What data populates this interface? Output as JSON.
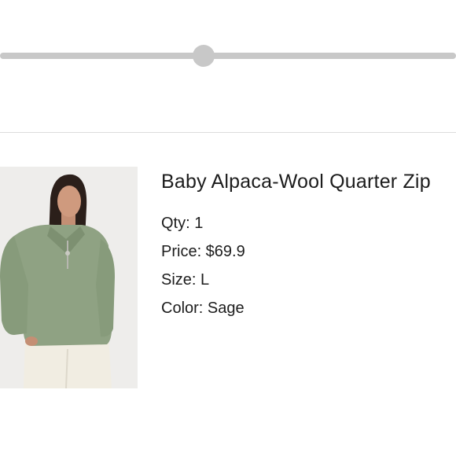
{
  "progress": {
    "value_percent": 44.6,
    "track_color": "#c8c8c8"
  },
  "product": {
    "name": "Baby Alpaca-Wool Quarter Zip",
    "image_icon": "product-photo",
    "sweater_color": "#8fa283",
    "details": [
      {
        "text": "Qty: 1"
      },
      {
        "text": "Price: $69.9"
      },
      {
        "text": "Size: L"
      },
      {
        "text": "Color: Sage"
      }
    ]
  }
}
